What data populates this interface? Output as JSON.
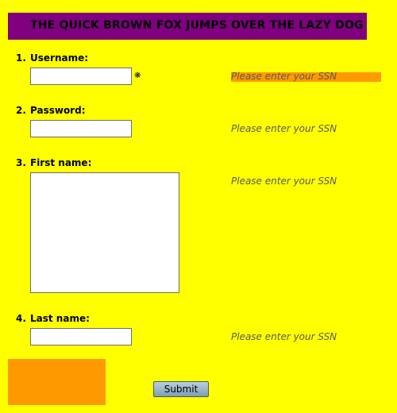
{
  "banner": {
    "title": "THE QUICK BROWN FOX JUMPS OVER THE LAZY DOG"
  },
  "colors": {
    "background": "#ffff00",
    "banner": "#800080",
    "highlight": "#ff9900"
  },
  "form": {
    "fields": [
      {
        "number": "1.",
        "label": "Username:",
        "value": "",
        "required": true,
        "required_icon": "asterisk-icon",
        "required_mark": "❋",
        "hint": "Please enter your SSN",
        "hint_highlighted": true
      },
      {
        "number": "2.",
        "label": "Password:",
        "value": "",
        "hint": "Please enter your SSN"
      },
      {
        "number": "3.",
        "label": "First name:",
        "value": "",
        "hint": "Please enter your SSN"
      },
      {
        "number": "4.",
        "label": "Last name:",
        "value": "",
        "hint": "Please enter your SSN"
      }
    ],
    "submit_label": "Submit"
  }
}
